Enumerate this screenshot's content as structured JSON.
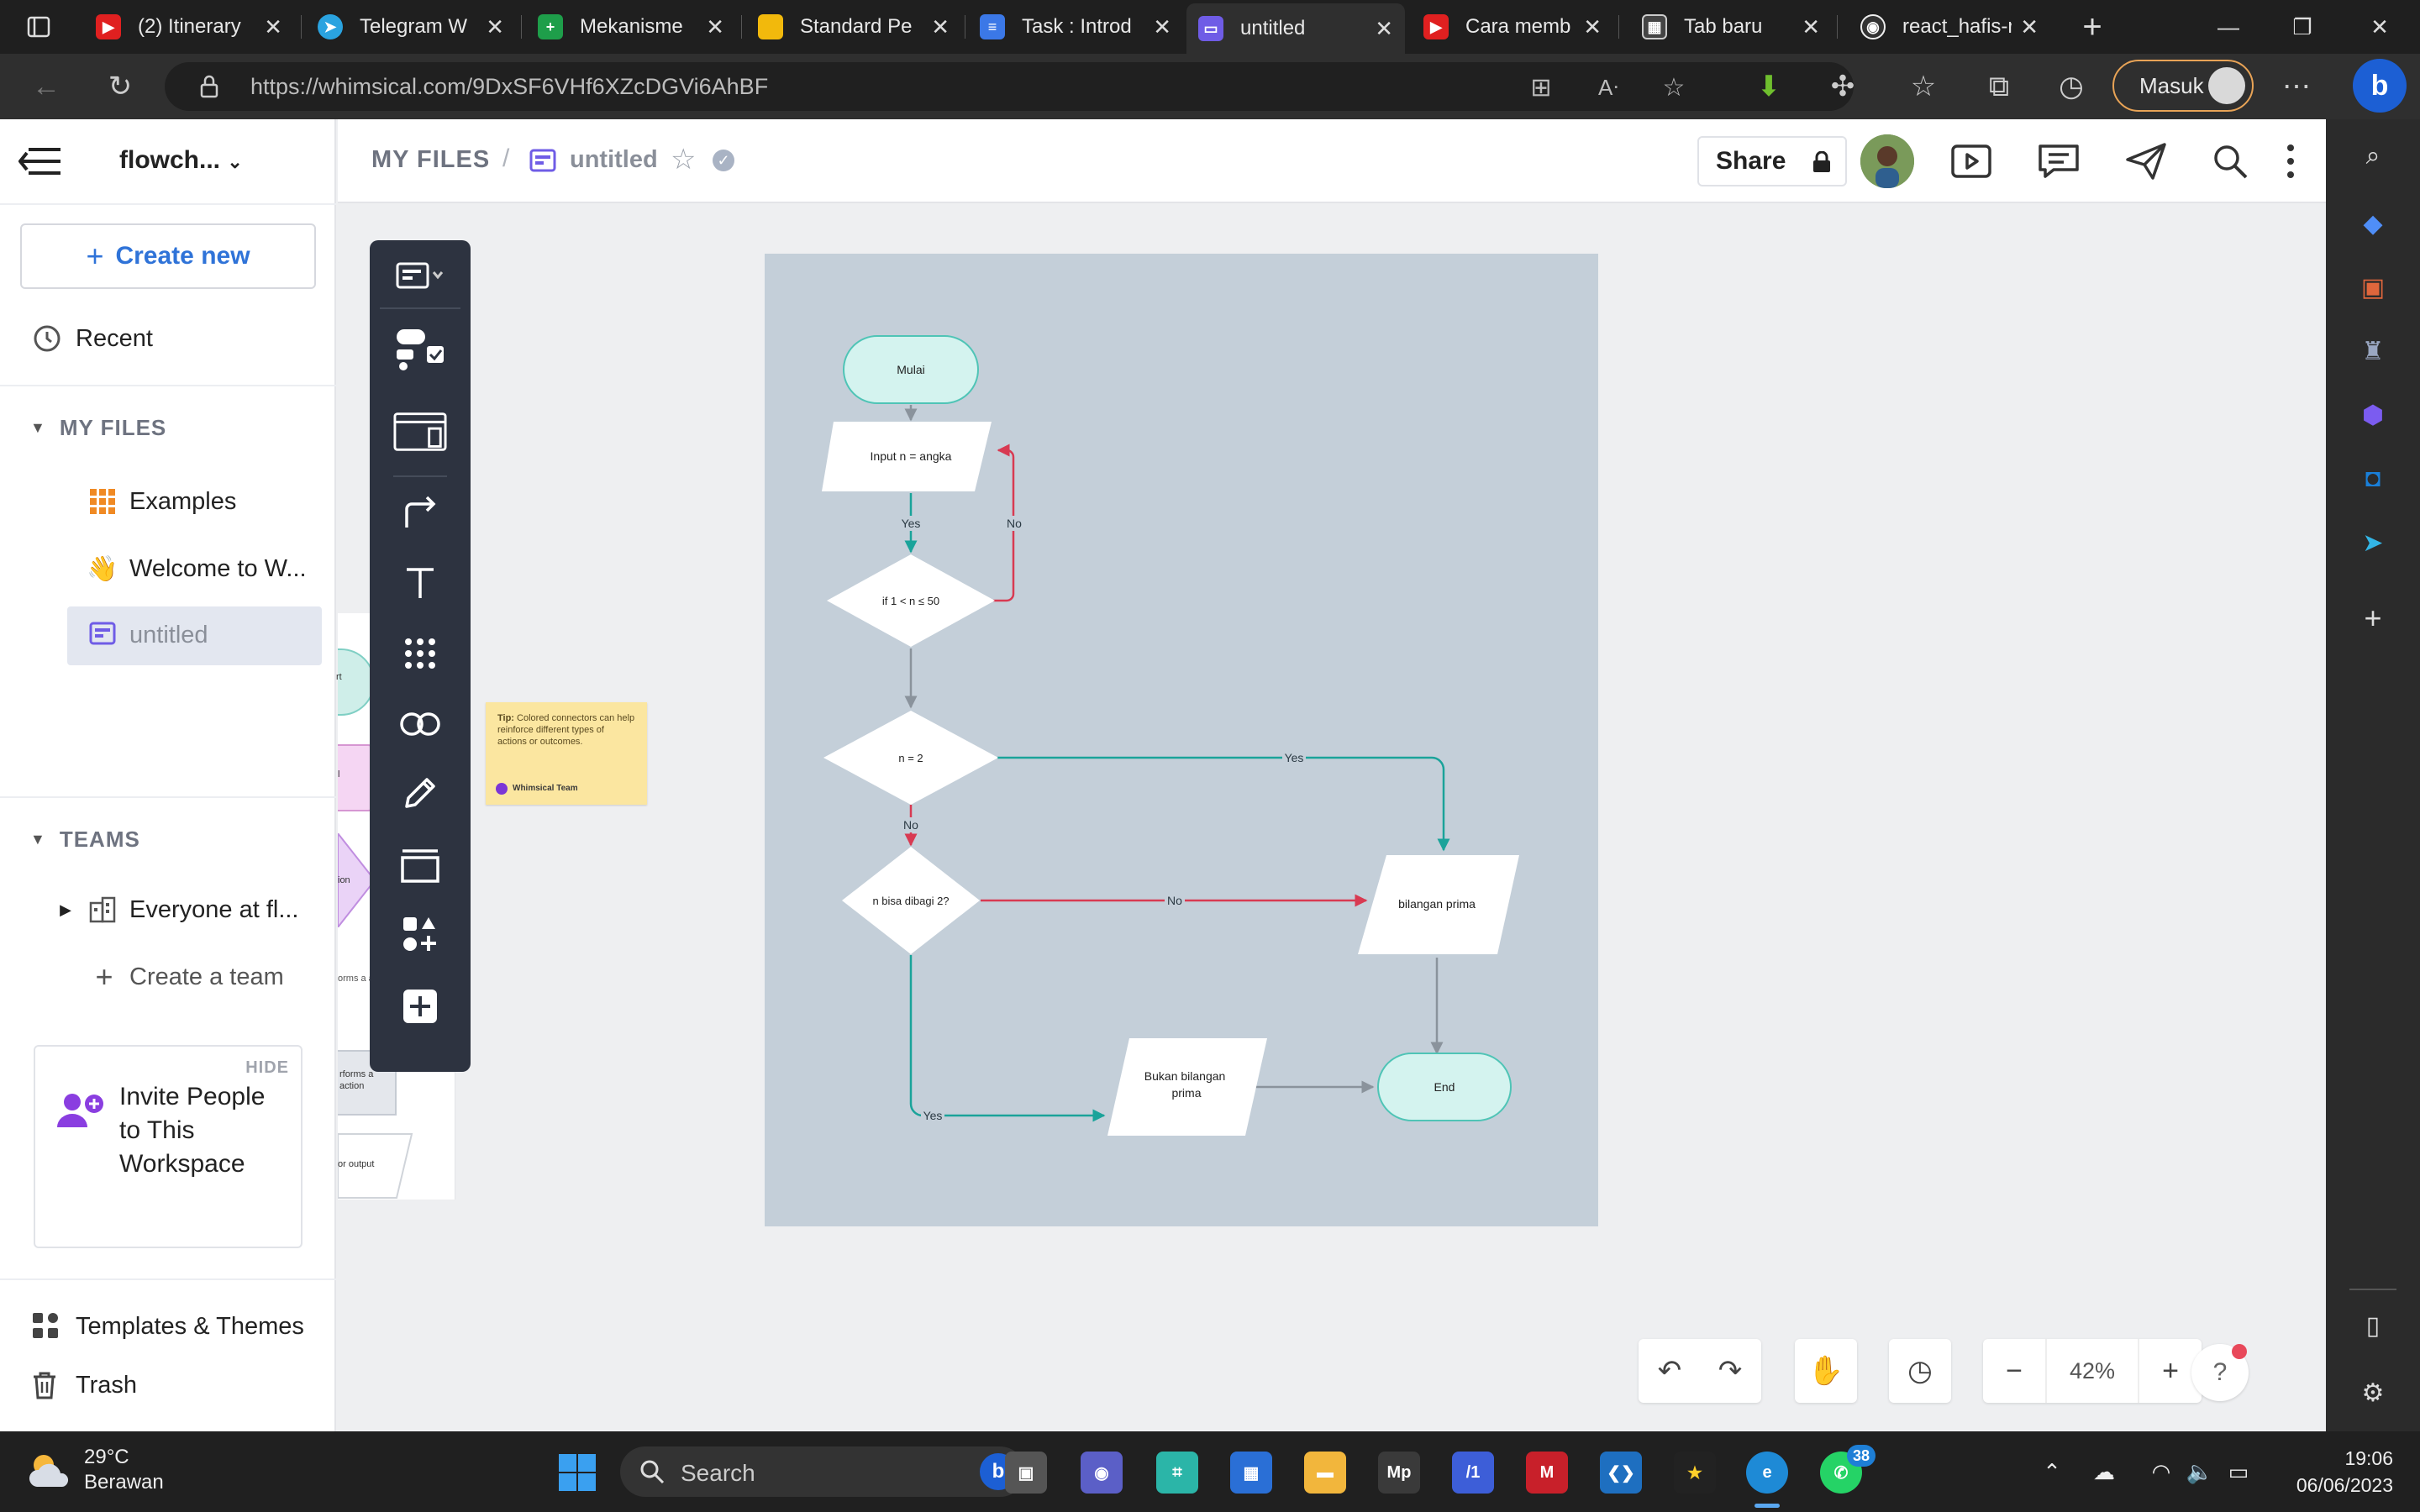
{
  "browser": {
    "tabs": [
      {
        "title": "(2) Itinerary",
        "color": "#e02020",
        "glyph": "▶"
      },
      {
        "title": "Telegram W",
        "color": "#2aa3e0",
        "glyph": "➤"
      },
      {
        "title": "Mekanisme",
        "color": "#1e9e4a",
        "glyph": "+"
      },
      {
        "title": "Standard Pe",
        "color": "#f2b90c",
        "glyph": ""
      },
      {
        "title": "Task : Introd",
        "color": "#3b78e7",
        "glyph": "≡"
      },
      {
        "title": "untitled",
        "color": "#6f5ce6",
        "glyph": "▭"
      },
      {
        "title": "Cara memb",
        "color": "#e02020",
        "glyph": "▶"
      },
      {
        "title": "Tab baru",
        "color": "#444444",
        "glyph": "▦"
      },
      {
        "title": "react_hafis-r",
        "color": "#333333",
        "glyph": "◉"
      }
    ],
    "url": "https://whimsical.com/9DxSF6VHf6XZcDGVi6AhBF",
    "profile_label": "Masuk"
  },
  "sidebar": {
    "workspace": "flowch...",
    "create_new": "Create new",
    "recent": "Recent",
    "my_files_label": "MY FILES",
    "files": [
      {
        "label": "Examples",
        "icon": "grid-icon"
      },
      {
        "label": "Welcome to W...",
        "icon": "wave-emoji"
      },
      {
        "label": "untitled",
        "icon": "board-icon"
      }
    ],
    "teams_label": "TEAMS",
    "team": "Everyone at fl...",
    "create_team": "Create a team",
    "invite": {
      "hide": "HIDE",
      "text": "Invite People to This Workspace"
    },
    "templates": "Templates & Themes",
    "trash": "Trash"
  },
  "header": {
    "breadcrumb_root": "MY FILES",
    "breadcrumb_sep": "/",
    "title": "untitled",
    "share": "Share"
  },
  "canvas": {
    "peek_labels": [
      "rt",
      "l",
      "ion",
      "orms a action",
      "rforms a action",
      "or output"
    ],
    "tip": {
      "bold": "Tip:",
      "text": "Colored connectors can help reinforce different types of actions or outcomes.",
      "author": "Whimsical Team"
    },
    "zoom": "42%"
  },
  "flowchart": {
    "nodes": {
      "start": "Mulai",
      "input": "Input n = angka",
      "cond1": "if 1 < n ≤ 50",
      "cond2": "n = 2",
      "cond3": "n bisa dibagi 2?",
      "prime": "bilangan prima",
      "notprime": "Bukan bilangan prima",
      "end": "End"
    },
    "edges": {
      "yes1": "Yes",
      "no1": "No",
      "yes2": "Yes",
      "no2": "No",
      "no3": "No",
      "yes3": "Yes"
    },
    "colors": {
      "teal": "#1aa39a",
      "red": "#d83a52",
      "gray": "#8a939c",
      "terminal_fill": "#d4f3ef",
      "board": "#c4cfd9"
    }
  },
  "taskbar": {
    "temperature": "29°C",
    "weather": "Berawan",
    "search": "Search",
    "badge": "38",
    "time": "19:06",
    "date": "06/06/2023"
  }
}
